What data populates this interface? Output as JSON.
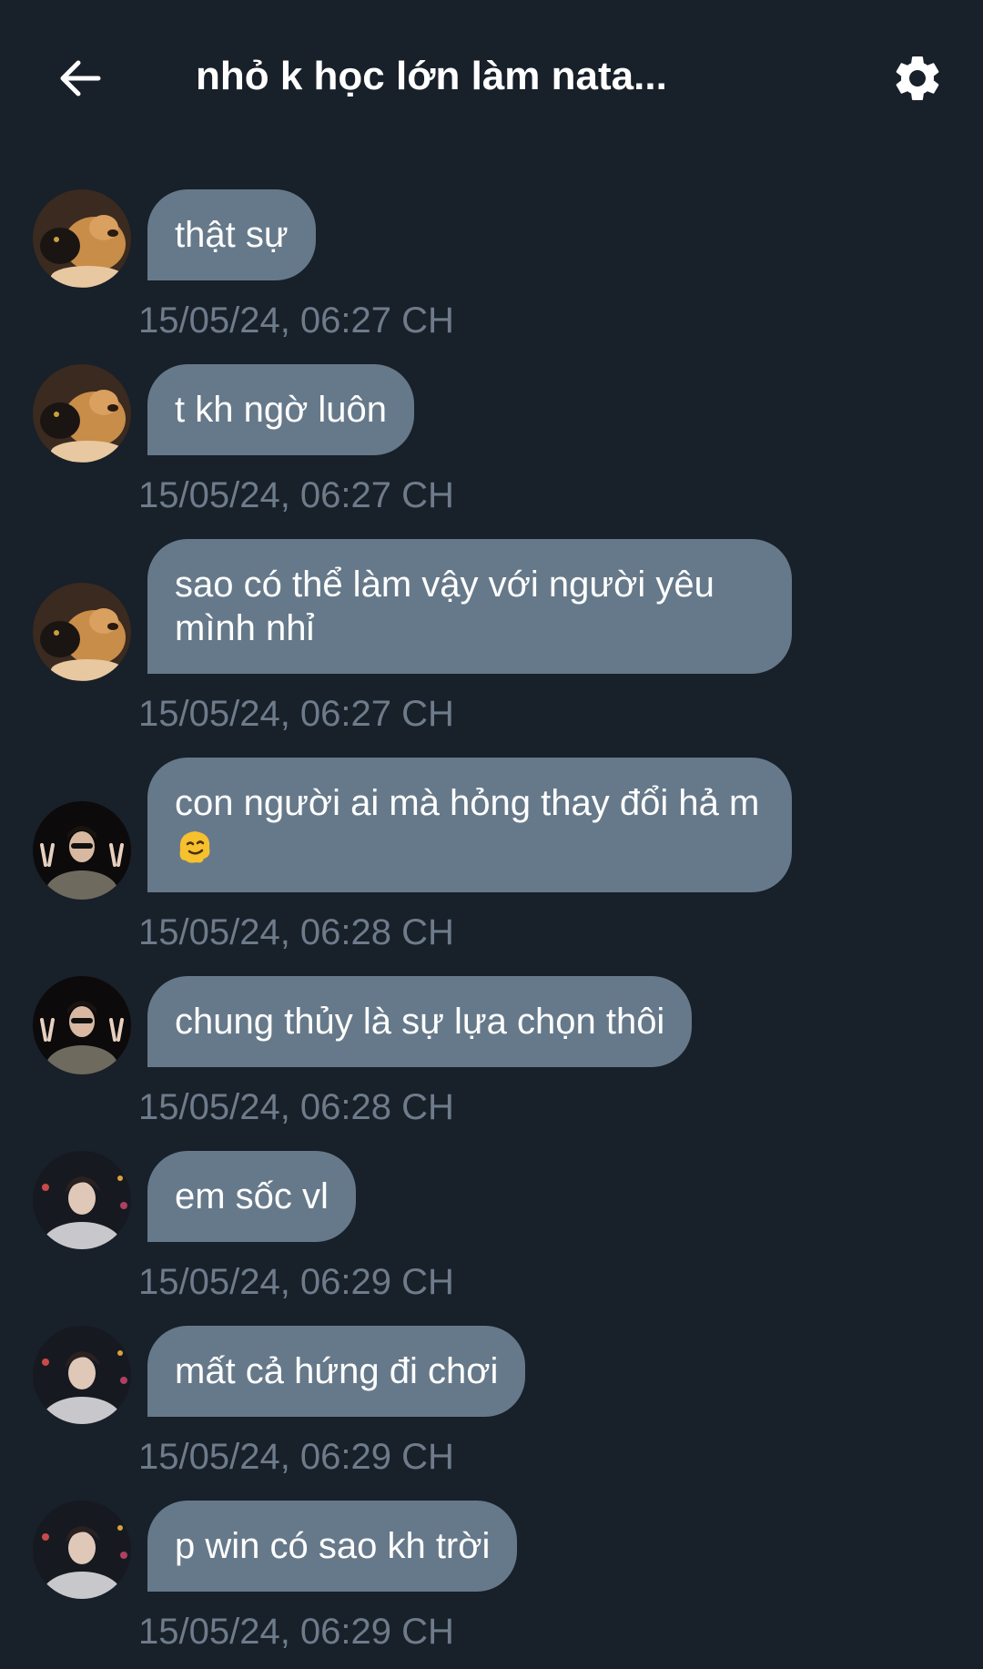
{
  "header": {
    "title": "nhỏ k học lớn làm nata...",
    "back_icon": "arrow-left-icon",
    "settings_icon": "gear-icon"
  },
  "colors": {
    "background": "#18202a",
    "bubble": "#66798a",
    "timestamp": "#6e7b8a"
  },
  "messages": [
    {
      "sender_avatar": "dog-cat-avatar",
      "text": "thật sự",
      "time": "15/05/24, 06:27 CH"
    },
    {
      "sender_avatar": "dog-cat-avatar",
      "text": "t kh ngờ luôn",
      "time": "15/05/24, 06:27 CH"
    },
    {
      "sender_avatar": "dog-cat-avatar",
      "text": "sao có thể làm vậy với người yêu mình nhỉ",
      "time": "15/05/24, 06:27 CH"
    },
    {
      "sender_avatar": "peace-sign-avatar",
      "text": "con người ai mà hỏng thay đổi hả m",
      "emoji": "melting-face-emoji",
      "time": "15/05/24, 06:28 CH"
    },
    {
      "sender_avatar": "peace-sign-avatar",
      "text": "chung thủy là sự lựa chọn thôi",
      "time": "15/05/24, 06:28 CH"
    },
    {
      "sender_avatar": "night-portrait-avatar",
      "text": "em sốc vl",
      "time": "15/05/24, 06:29 CH"
    },
    {
      "sender_avatar": "night-portrait-avatar",
      "text": "mất cả hứng đi chơi",
      "time": "15/05/24, 06:29 CH"
    },
    {
      "sender_avatar": "night-portrait-avatar",
      "text": "p win có sao kh trời",
      "time": "15/05/24, 06:29 CH"
    }
  ]
}
